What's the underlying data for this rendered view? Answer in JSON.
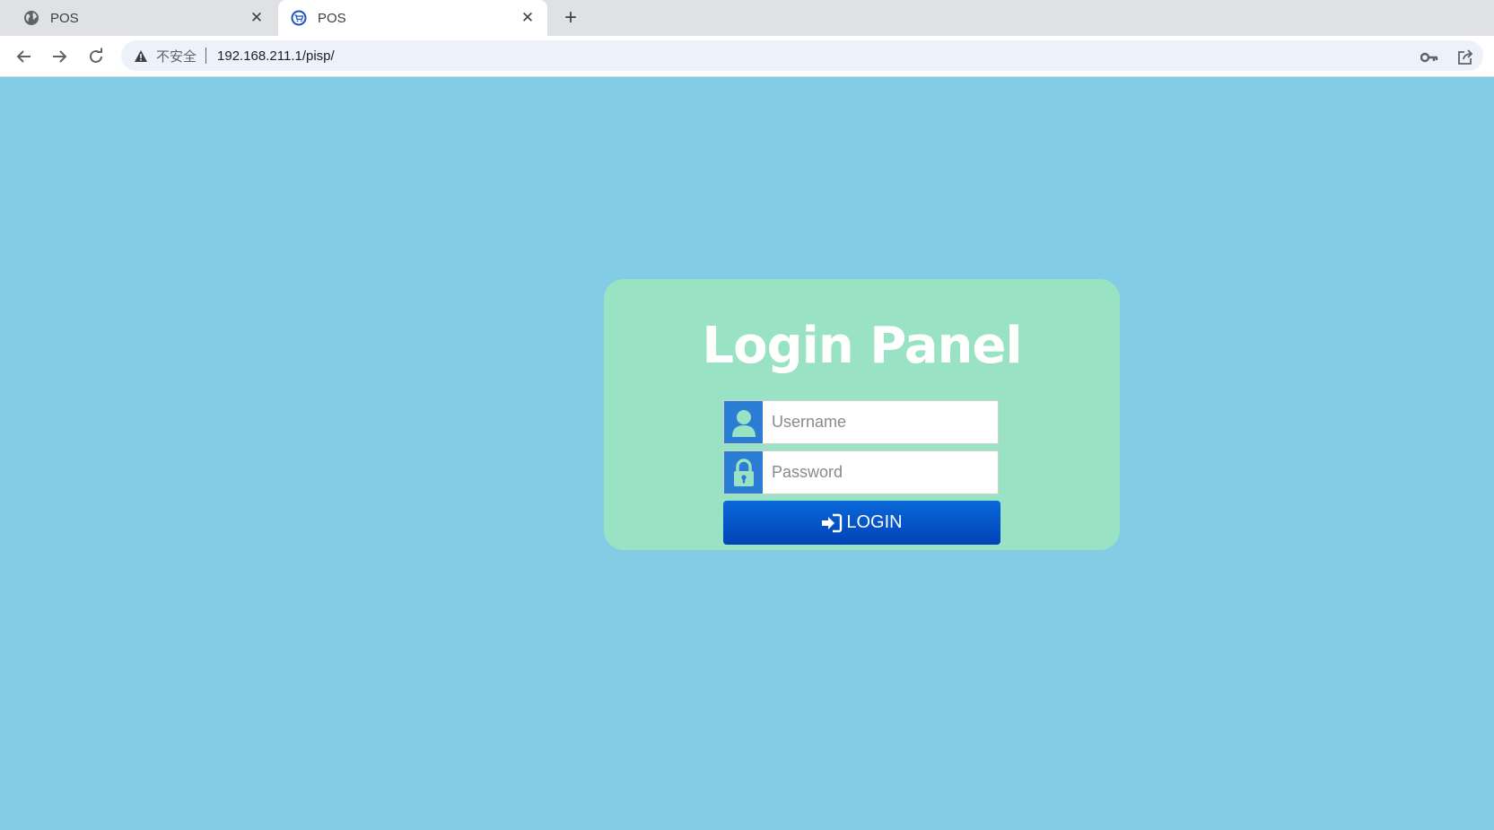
{
  "browser": {
    "tabs": [
      {
        "title": "POS",
        "favicon": "globe-icon",
        "active": false
      },
      {
        "title": "POS",
        "favicon": "shopping-cart-icon",
        "active": true
      }
    ],
    "new_tab_icon": "plus-icon",
    "close_icon": "close-icon",
    "security_label": "不安全",
    "url": "192.168.211.1/pisp/"
  },
  "login": {
    "title": "Login Panel",
    "username_placeholder": "Username",
    "password_placeholder": "Password",
    "button_label": "LOGIN"
  },
  "colors": {
    "page_background": "#82cde5",
    "panel_background": "#9ae2c4",
    "addon_blue": "#2b7cd3",
    "button_blue": "#0a68d8"
  }
}
